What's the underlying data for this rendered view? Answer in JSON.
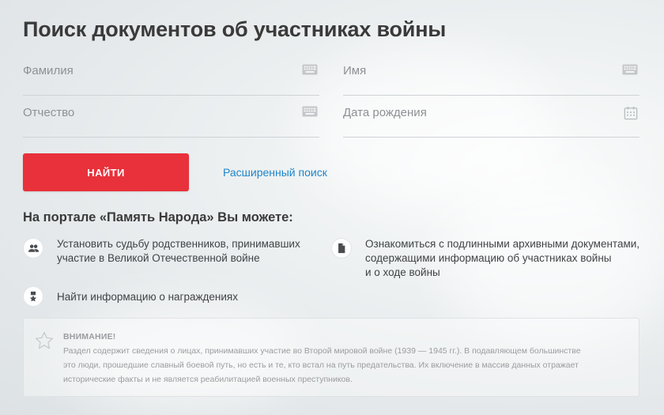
{
  "page": {
    "title": "Поиск документов об участниках войны"
  },
  "form": {
    "surname_placeholder": "Фамилия",
    "name_placeholder": "Имя",
    "patronymic_placeholder": "Отчество",
    "birthdate_placeholder": "Дата рождения",
    "keyboard_icon": "keyboard-icon",
    "calendar_icon": "calendar-icon",
    "search_button": "НАЙТИ",
    "advanced_link": "Расширенный поиск"
  },
  "features": {
    "heading": "На портале «Память Народа» Вы можете:",
    "items": [
      {
        "icon": "people-icon",
        "lines": [
          "Установить судьбу родственников, принимавших",
          "участие в Великой Отечественной войне"
        ]
      },
      {
        "icon": "document-icon",
        "lines": [
          "Ознакомиться с подлинными архивными документами,",
          "содержащими информацию об участниках войны",
          "и о ходе войны"
        ]
      },
      {
        "icon": "medal-icon",
        "lines": [
          "Найти информацию о награждениях"
        ]
      }
    ]
  },
  "notice": {
    "icon": "star-icon",
    "title": "ВНИМАНИЕ!",
    "lines": [
      "Раздел содержит сведения о лицах, принимавших участие во Второй мировой войне (1939 — 1945 гг.). В подавляющем большинстве",
      "это люди, прошедшие славный боевой путь, но есть и те, кто встал на путь предательства. Их включение в массив данных отражает",
      "исторические факты и не является реабилитацией военных преступников."
    ]
  },
  "colors": {
    "accent": "#e8313b",
    "link": "#1f86c9",
    "heading": "#3a3a3a",
    "muted": "#9a9da0"
  }
}
